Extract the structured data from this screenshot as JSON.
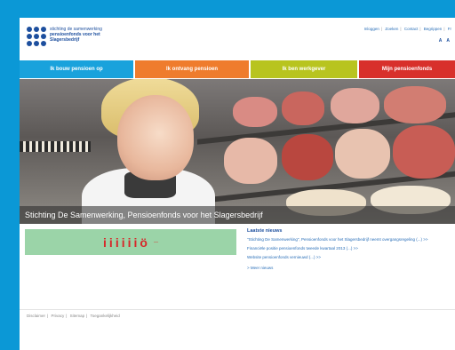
{
  "logo": {
    "line1": "stichting de samenwerking",
    "line2": "pensioenfonds voor het",
    "line3": "Slagersbedrijf"
  },
  "toplinks": [
    "Inloggen",
    "Zoeken",
    "Contact",
    "Begrippen",
    "Fr"
  ],
  "fontsize": {
    "small": "A",
    "large": "A"
  },
  "nav": [
    {
      "label": "Ik bouw pensioen op"
    },
    {
      "label": "Ik ontvang pensioen"
    },
    {
      "label": "Ik ben werkgever"
    },
    {
      "label": "Mijn pensioenfonds"
    }
  ],
  "hero": {
    "caption": "Stichting De Samenwerking, Pensioenfonds voor het Slagersbedrijf"
  },
  "banner": {
    "figures": "iiiiiiö",
    "tag": "—"
  },
  "news": {
    "title": "Laatste nieuws",
    "items": [
      "\"Stichting De Samenwerking\", Pensioenfonds voor het Slagersbedrijf neemt overgangsregeling (...) >>",
      "Financiële positie pensioenfonds tweede kwartaal 2013 (...) >>",
      "Website pensioenfonds vernieuwd (...) >>"
    ],
    "more": "> Meer nieuws"
  },
  "footer": [
    "Disclaimer",
    "Privacy",
    "Sitemap",
    "Toegankelijkheid"
  ]
}
